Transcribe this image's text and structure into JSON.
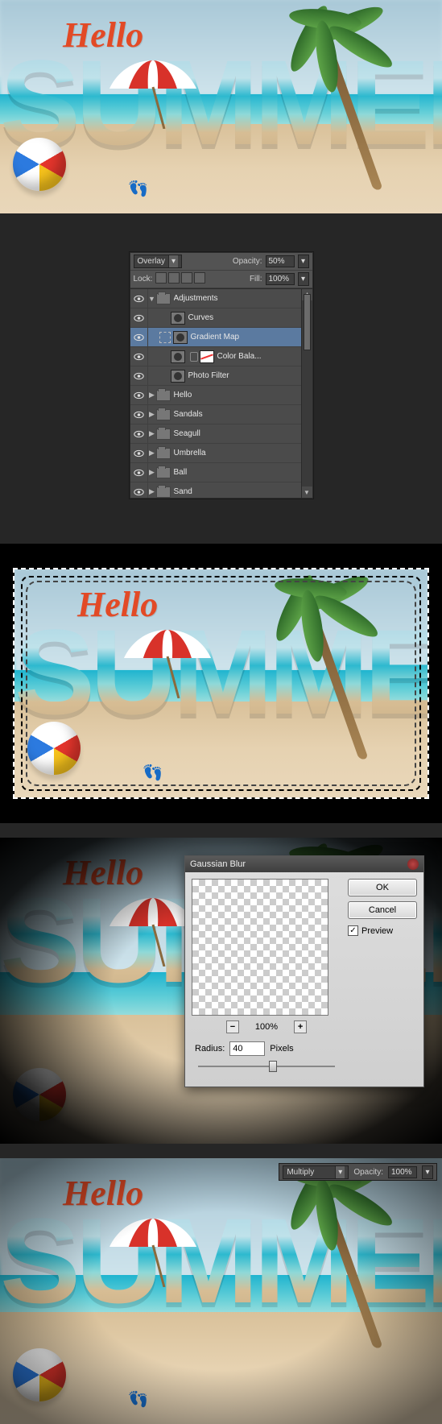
{
  "artwork": {
    "hello_text": "Hello",
    "main_text": "SUMMER"
  },
  "layers_panel": {
    "blend_mode": "Overlay",
    "opacity_label": "Opacity:",
    "opacity_value": "50%",
    "lock_label": "Lock:",
    "fill_label": "Fill:",
    "fill_value": "100%",
    "layers": [
      {
        "name": "Adjustments",
        "type": "group",
        "expanded": true,
        "indent": 0
      },
      {
        "name": "Curves",
        "type": "adj",
        "indent": 2
      },
      {
        "name": "Gradient Map",
        "type": "adj",
        "indent": 1,
        "selected": true
      },
      {
        "name": "Color Bala...",
        "type": "adj-mask",
        "indent": 2
      },
      {
        "name": "Photo Filter",
        "type": "adj",
        "indent": 2
      },
      {
        "name": "Hello",
        "type": "group",
        "expanded": false,
        "indent": 0
      },
      {
        "name": "Sandals",
        "type": "group",
        "expanded": false,
        "indent": 0
      },
      {
        "name": "Seagull",
        "type": "group",
        "expanded": false,
        "indent": 0
      },
      {
        "name": "Umbrella",
        "type": "group",
        "expanded": false,
        "indent": 0
      },
      {
        "name": "Ball",
        "type": "group",
        "expanded": false,
        "indent": 0
      },
      {
        "name": "Sand",
        "type": "group",
        "expanded": false,
        "indent": 0
      }
    ]
  },
  "gaussian_dialog": {
    "title": "Gaussian Blur",
    "ok_label": "OK",
    "cancel_label": "Cancel",
    "preview_label": "Preview",
    "preview_checked": true,
    "zoom_value": "100%",
    "radius_label": "Radius:",
    "radius_value": "40",
    "radius_unit": "Pixels"
  },
  "multiply_panel": {
    "blend_mode": "Multiply",
    "opacity_label": "Opacity:",
    "opacity_value": "100%"
  },
  "icons": {
    "dropdown": "▾",
    "tri_right": "▶",
    "tri_down": "▼",
    "minus": "−",
    "plus": "+",
    "check": "✓"
  }
}
